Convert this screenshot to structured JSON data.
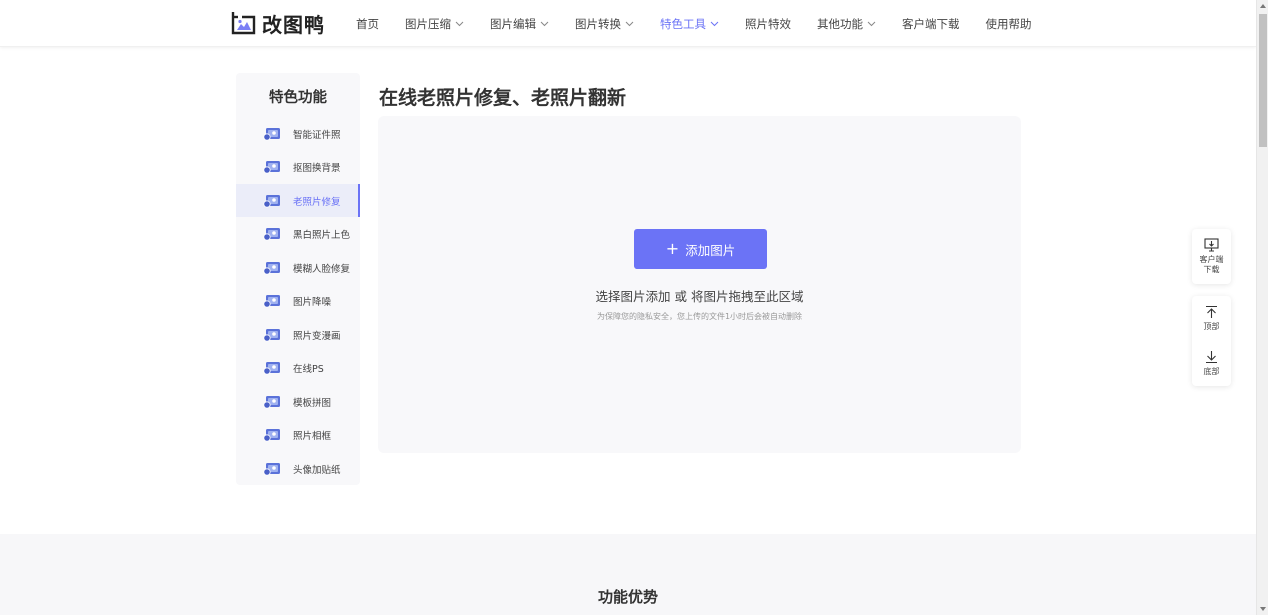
{
  "header": {
    "logo_text": "改图鸭",
    "nav": [
      {
        "label": "首页",
        "dropdown": false,
        "active": false
      },
      {
        "label": "图片压缩",
        "dropdown": true,
        "active": false
      },
      {
        "label": "图片编辑",
        "dropdown": true,
        "active": false
      },
      {
        "label": "图片转换",
        "dropdown": true,
        "active": false
      },
      {
        "label": "特色工具",
        "dropdown": true,
        "active": true
      },
      {
        "label": "照片特效",
        "dropdown": false,
        "active": false
      },
      {
        "label": "其他功能",
        "dropdown": true,
        "active": false
      },
      {
        "label": "客户端下载",
        "dropdown": false,
        "active": false
      },
      {
        "label": "使用帮助",
        "dropdown": false,
        "active": false
      }
    ]
  },
  "sidebar": {
    "title": "特色功能",
    "items": [
      {
        "label": "智能证件照",
        "icon": "id-photo-icon"
      },
      {
        "label": "抠图换背景",
        "icon": "cutout-icon"
      },
      {
        "label": "老照片修复",
        "icon": "old-photo-icon",
        "active": true
      },
      {
        "label": "黑白照片上色",
        "icon": "colorize-icon"
      },
      {
        "label": "模糊人脸修复",
        "icon": "face-repair-icon"
      },
      {
        "label": "图片降噪",
        "icon": "denoise-icon"
      },
      {
        "label": "照片变漫画",
        "icon": "cartoon-icon"
      },
      {
        "label": "在线PS",
        "icon": "ps-icon"
      },
      {
        "label": "模板拼图",
        "icon": "collage-icon"
      },
      {
        "label": "照片相框",
        "icon": "frame-icon"
      },
      {
        "label": "头像加贴纸",
        "icon": "sticker-icon"
      }
    ]
  },
  "main": {
    "title": "在线老照片修复、老照片翻新",
    "add_button": "添加图片",
    "hint": "选择图片添加 或 将图片拖拽至此区域",
    "note": "为保障您的隐私安全，您上传的文件1小时后会被自动删除"
  },
  "float_tools": {
    "client": "客户端下载",
    "client_line1": "客户端",
    "client_line2": "下载",
    "top": "顶部",
    "bottom": "底部"
  },
  "bottom": {
    "title": "功能优势"
  },
  "colors": {
    "accent": "#6b73f6",
    "sidebar_bg": "#f8f8fa",
    "active_bg": "#ebedf9"
  }
}
